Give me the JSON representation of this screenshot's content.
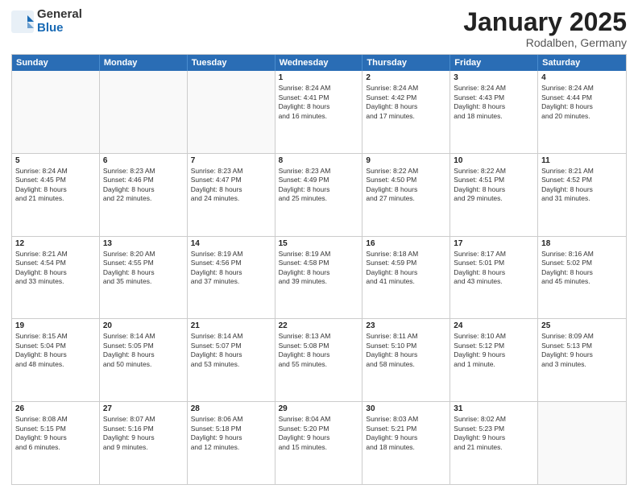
{
  "logo": {
    "general": "General",
    "blue": "Blue"
  },
  "title": "January 2025",
  "subtitle": "Rodalben, Germany",
  "header_days": [
    "Sunday",
    "Monday",
    "Tuesday",
    "Wednesday",
    "Thursday",
    "Friday",
    "Saturday"
  ],
  "weeks": [
    [
      {
        "day": "",
        "info": ""
      },
      {
        "day": "",
        "info": ""
      },
      {
        "day": "",
        "info": ""
      },
      {
        "day": "1",
        "info": "Sunrise: 8:24 AM\nSunset: 4:41 PM\nDaylight: 8 hours\nand 16 minutes."
      },
      {
        "day": "2",
        "info": "Sunrise: 8:24 AM\nSunset: 4:42 PM\nDaylight: 8 hours\nand 17 minutes."
      },
      {
        "day": "3",
        "info": "Sunrise: 8:24 AM\nSunset: 4:43 PM\nDaylight: 8 hours\nand 18 minutes."
      },
      {
        "day": "4",
        "info": "Sunrise: 8:24 AM\nSunset: 4:44 PM\nDaylight: 8 hours\nand 20 minutes."
      }
    ],
    [
      {
        "day": "5",
        "info": "Sunrise: 8:24 AM\nSunset: 4:45 PM\nDaylight: 8 hours\nand 21 minutes."
      },
      {
        "day": "6",
        "info": "Sunrise: 8:23 AM\nSunset: 4:46 PM\nDaylight: 8 hours\nand 22 minutes."
      },
      {
        "day": "7",
        "info": "Sunrise: 8:23 AM\nSunset: 4:47 PM\nDaylight: 8 hours\nand 24 minutes."
      },
      {
        "day": "8",
        "info": "Sunrise: 8:23 AM\nSunset: 4:49 PM\nDaylight: 8 hours\nand 25 minutes."
      },
      {
        "day": "9",
        "info": "Sunrise: 8:22 AM\nSunset: 4:50 PM\nDaylight: 8 hours\nand 27 minutes."
      },
      {
        "day": "10",
        "info": "Sunrise: 8:22 AM\nSunset: 4:51 PM\nDaylight: 8 hours\nand 29 minutes."
      },
      {
        "day": "11",
        "info": "Sunrise: 8:21 AM\nSunset: 4:52 PM\nDaylight: 8 hours\nand 31 minutes."
      }
    ],
    [
      {
        "day": "12",
        "info": "Sunrise: 8:21 AM\nSunset: 4:54 PM\nDaylight: 8 hours\nand 33 minutes."
      },
      {
        "day": "13",
        "info": "Sunrise: 8:20 AM\nSunset: 4:55 PM\nDaylight: 8 hours\nand 35 minutes."
      },
      {
        "day": "14",
        "info": "Sunrise: 8:19 AM\nSunset: 4:56 PM\nDaylight: 8 hours\nand 37 minutes."
      },
      {
        "day": "15",
        "info": "Sunrise: 8:19 AM\nSunset: 4:58 PM\nDaylight: 8 hours\nand 39 minutes."
      },
      {
        "day": "16",
        "info": "Sunrise: 8:18 AM\nSunset: 4:59 PM\nDaylight: 8 hours\nand 41 minutes."
      },
      {
        "day": "17",
        "info": "Sunrise: 8:17 AM\nSunset: 5:01 PM\nDaylight: 8 hours\nand 43 minutes."
      },
      {
        "day": "18",
        "info": "Sunrise: 8:16 AM\nSunset: 5:02 PM\nDaylight: 8 hours\nand 45 minutes."
      }
    ],
    [
      {
        "day": "19",
        "info": "Sunrise: 8:15 AM\nSunset: 5:04 PM\nDaylight: 8 hours\nand 48 minutes."
      },
      {
        "day": "20",
        "info": "Sunrise: 8:14 AM\nSunset: 5:05 PM\nDaylight: 8 hours\nand 50 minutes."
      },
      {
        "day": "21",
        "info": "Sunrise: 8:14 AM\nSunset: 5:07 PM\nDaylight: 8 hours\nand 53 minutes."
      },
      {
        "day": "22",
        "info": "Sunrise: 8:13 AM\nSunset: 5:08 PM\nDaylight: 8 hours\nand 55 minutes."
      },
      {
        "day": "23",
        "info": "Sunrise: 8:11 AM\nSunset: 5:10 PM\nDaylight: 8 hours\nand 58 minutes."
      },
      {
        "day": "24",
        "info": "Sunrise: 8:10 AM\nSunset: 5:12 PM\nDaylight: 9 hours\nand 1 minute."
      },
      {
        "day": "25",
        "info": "Sunrise: 8:09 AM\nSunset: 5:13 PM\nDaylight: 9 hours\nand 3 minutes."
      }
    ],
    [
      {
        "day": "26",
        "info": "Sunrise: 8:08 AM\nSunset: 5:15 PM\nDaylight: 9 hours\nand 6 minutes."
      },
      {
        "day": "27",
        "info": "Sunrise: 8:07 AM\nSunset: 5:16 PM\nDaylight: 9 hours\nand 9 minutes."
      },
      {
        "day": "28",
        "info": "Sunrise: 8:06 AM\nSunset: 5:18 PM\nDaylight: 9 hours\nand 12 minutes."
      },
      {
        "day": "29",
        "info": "Sunrise: 8:04 AM\nSunset: 5:20 PM\nDaylight: 9 hours\nand 15 minutes."
      },
      {
        "day": "30",
        "info": "Sunrise: 8:03 AM\nSunset: 5:21 PM\nDaylight: 9 hours\nand 18 minutes."
      },
      {
        "day": "31",
        "info": "Sunrise: 8:02 AM\nSunset: 5:23 PM\nDaylight: 9 hours\nand 21 minutes."
      },
      {
        "day": "",
        "info": ""
      }
    ]
  ]
}
